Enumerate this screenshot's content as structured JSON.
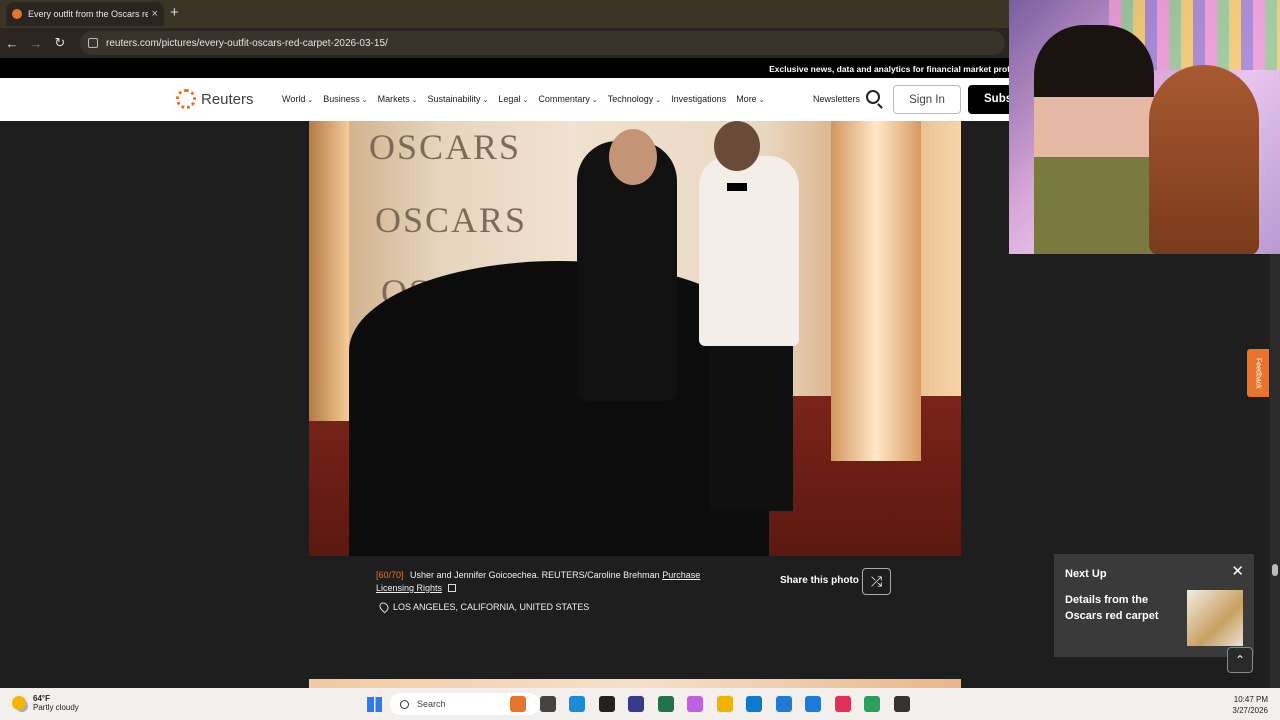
{
  "browser": {
    "tab_title": "Every outfit from the Oscars red",
    "tab_close": "×",
    "new_tab": "+",
    "url": "reuters.com/pictures/every-outfit-oscars-red-carpet-2026-03-15/"
  },
  "site": {
    "promo": "Exclusive news, data and analytics for financial market prof",
    "logo": "Reuters",
    "nav": [
      {
        "label": "World",
        "caret": "⌄"
      },
      {
        "label": "Business",
        "caret": "⌄"
      },
      {
        "label": "Markets",
        "caret": "⌄"
      },
      {
        "label": "Sustainability",
        "caret": "⌄"
      },
      {
        "label": "Legal",
        "caret": "⌄"
      },
      {
        "label": "Commentary",
        "caret": "⌄"
      },
      {
        "label": "Technology",
        "caret": "⌄"
      },
      {
        "label": "Investigations",
        "caret": ""
      },
      {
        "label": "More",
        "caret": "⌄"
      }
    ],
    "newsletters": "Newsletters",
    "sign_in": "Sign In",
    "subscribe": "Subs"
  },
  "photo": {
    "wordmarks": [
      "OSCARS",
      "OSCARS",
      "OSCARS"
    ],
    "index": "[60/70]",
    "caption": "Usher and Jennifer Goicoechea. REUTERS/Caroline Brehman",
    "license_link": "Purchase Licensing Rights",
    "location": "LOS ANGELES, CALIFORNIA, UNITED STATES",
    "share_label": "Share this photo"
  },
  "next_up": {
    "heading": "Next Up",
    "title": "Details from the Oscars red carpet",
    "close": "✕"
  },
  "feedback": "Feedback",
  "taskbar": {
    "weather_temp": "64°F",
    "weather_desc": "Partly cloudy",
    "search_placeholder": "Search",
    "time": "10:47 PM",
    "date": "3/27/2026",
    "app_colors": [
      "#e8742c",
      "#444444",
      "#1d8ad8",
      "#222222",
      "#3a3a8a",
      "#21734a",
      "#c060e0",
      "#f0b400",
      "#0a7ad0",
      "#1d7ad8",
      "#1d7ad8",
      "#e0305a",
      "#2e9e5c",
      "#333333"
    ]
  }
}
